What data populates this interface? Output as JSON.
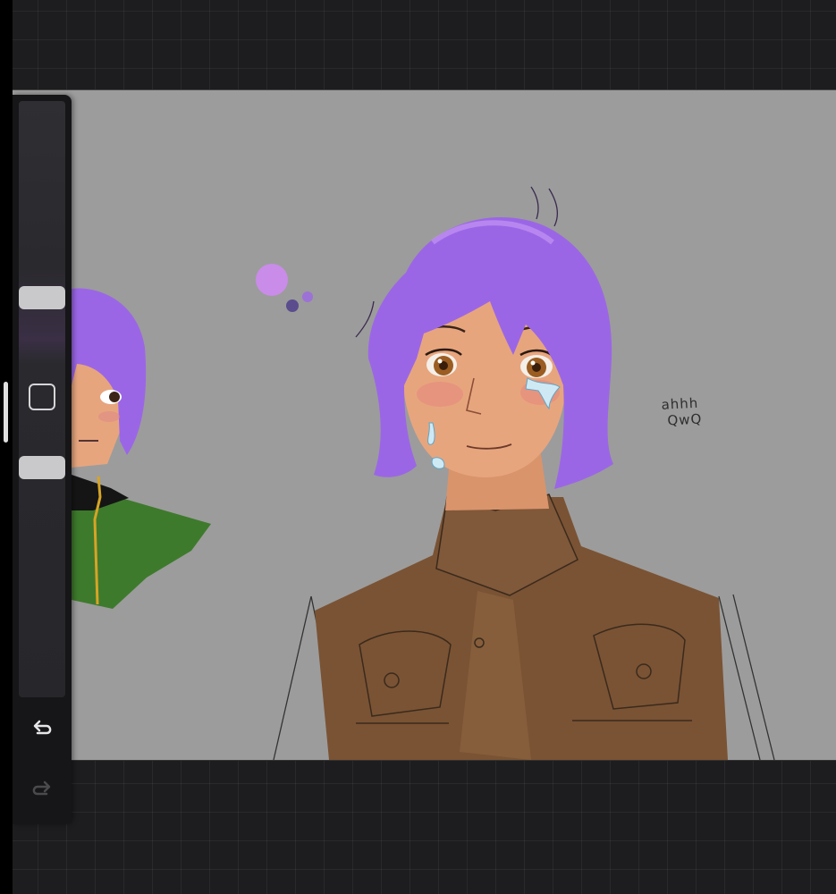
{
  "canvas": {
    "background": "#9c9c9c",
    "annotation_lines": [
      "ahhh",
      "QwQ"
    ]
  },
  "colors": {
    "hair": "#9b66e6",
    "vest": "#7a5334",
    "jacket_green": "#3e7a2c",
    "skin": "#e7a57e",
    "workspace": "#1d1d1f"
  },
  "sidebar": {
    "size_slider": {
      "value": 0.32
    },
    "opacity_slider": {
      "value": 0.61
    },
    "icons": {
      "modify": "square-icon",
      "undo": "undo-arrow-icon",
      "redo": "redo-arrow-icon"
    }
  }
}
